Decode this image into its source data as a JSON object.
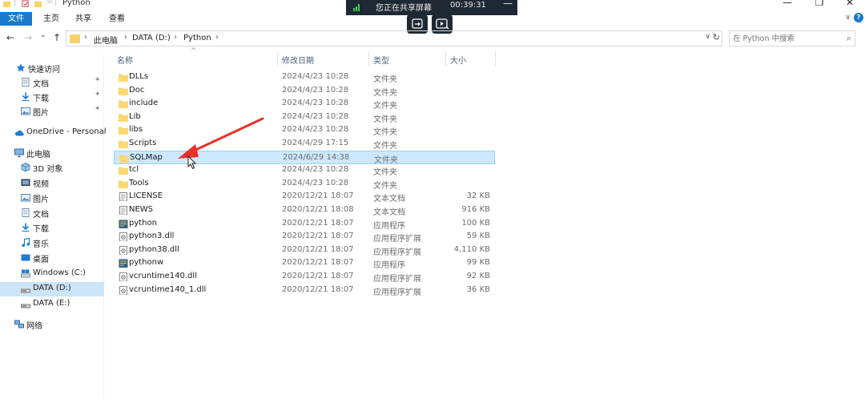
{
  "window": {
    "title": "Python",
    "controls": {
      "minimize": "—",
      "maximize": "❐",
      "close": "✕"
    }
  },
  "ribbon": {
    "tabs": [
      "文件",
      "主页",
      "共享",
      "查看"
    ],
    "collapse_glyph": "∨",
    "help_glyph": "?"
  },
  "share_overlay": {
    "status": "您正在共享屏幕",
    "timer": "00:39:31",
    "minimize_glyph": "—"
  },
  "navigation": {
    "back": "←",
    "forward": "→",
    "recent": "⌄",
    "up": "↑"
  },
  "address": {
    "breadcrumbs": [
      "此电脑",
      "DATA (D:)",
      "Python"
    ],
    "dropdown_glyph": "∨",
    "refresh_glyph": "↻"
  },
  "search": {
    "placeholder": "在 Python 中搜索",
    "icon_glyph": "⌕"
  },
  "nav_pane": {
    "items": [
      {
        "label": "快速访问",
        "icon": "star-icon",
        "pinned": false
      },
      {
        "label": "文档",
        "icon": "documents-icon",
        "pinned": true
      },
      {
        "label": "下载",
        "icon": "download-icon",
        "pinned": true
      },
      {
        "label": "图片",
        "icon": "pictures-icon",
        "pinned": true
      },
      {
        "label": "OneDrive - Personal",
        "icon": "cloud-icon",
        "pinned": false
      },
      {
        "label": "此电脑",
        "icon": "computer-icon",
        "pinned": false
      },
      {
        "label": "3D 对象",
        "icon": "3d-objects-icon",
        "pinned": false
      },
      {
        "label": "视频",
        "icon": "videos-icon",
        "pinned": false
      },
      {
        "label": "图片",
        "icon": "pictures-icon",
        "pinned": false
      },
      {
        "label": "文档",
        "icon": "documents-icon",
        "pinned": false
      },
      {
        "label": "下载",
        "icon": "download-icon",
        "pinned": false
      },
      {
        "label": "音乐",
        "icon": "music-icon",
        "pinned": false
      },
      {
        "label": "桌面",
        "icon": "desktop-icon",
        "pinned": false
      },
      {
        "label": "Windows (C:)",
        "icon": "drive-c-icon",
        "pinned": false
      },
      {
        "label": "DATA (D:)",
        "icon": "drive-icon",
        "pinned": false,
        "selected": true
      },
      {
        "label": "DATA (E:)",
        "icon": "drive-icon",
        "pinned": false
      },
      {
        "label": "网络",
        "icon": "network-icon",
        "pinned": false
      }
    ],
    "pin_glyph": "✦"
  },
  "columns": {
    "name": "名称",
    "date": "修改日期",
    "type": "类型",
    "size": "大小",
    "sort_glyph": "^"
  },
  "files": [
    {
      "name": "DLLs",
      "date": "2024/4/23 10:28",
      "type": "文件夹",
      "size": "",
      "icon": "folder-icon"
    },
    {
      "name": "Doc",
      "date": "2024/4/23 10:28",
      "type": "文件夹",
      "size": "",
      "icon": "folder-icon"
    },
    {
      "name": "include",
      "date": "2024/4/23 10:28",
      "type": "文件夹",
      "size": "",
      "icon": "folder-icon"
    },
    {
      "name": "Lib",
      "date": "2024/4/23 10:28",
      "type": "文件夹",
      "size": "",
      "icon": "folder-icon"
    },
    {
      "name": "libs",
      "date": "2024/4/23 10:28",
      "type": "文件夹",
      "size": "",
      "icon": "folder-icon"
    },
    {
      "name": "Scripts",
      "date": "2024/4/29 17:15",
      "type": "文件夹",
      "size": "",
      "icon": "folder-icon"
    },
    {
      "name": "SQLMap",
      "date": "2024/6/29 14:38",
      "type": "文件夹",
      "size": "",
      "icon": "folder-icon",
      "selected": true
    },
    {
      "name": "tcl",
      "date": "2024/4/23 10:28",
      "type": "文件夹",
      "size": "",
      "icon": "folder-icon"
    },
    {
      "name": "Tools",
      "date": "2024/4/23 10:28",
      "type": "文件夹",
      "size": "",
      "icon": "folder-icon"
    },
    {
      "name": "LICENSE",
      "date": "2020/12/21 18:07",
      "type": "文本文档",
      "size": "32 KB",
      "icon": "text-file-icon"
    },
    {
      "name": "NEWS",
      "date": "2020/12/21 18:08",
      "type": "文本文档",
      "size": "916 KB",
      "icon": "text-file-icon"
    },
    {
      "name": "python",
      "date": "2020/12/21 18:07",
      "type": "应用程序",
      "size": "100 KB",
      "icon": "python-app-icon"
    },
    {
      "name": "python3.dll",
      "date": "2020/12/21 18:07",
      "type": "应用程序扩展",
      "size": "59 KB",
      "icon": "dll-icon"
    },
    {
      "name": "python38.dll",
      "date": "2020/12/21 18:07",
      "type": "应用程序扩展",
      "size": "4,110 KB",
      "icon": "dll-icon"
    },
    {
      "name": "pythonw",
      "date": "2020/12/21 18:07",
      "type": "应用程序",
      "size": "99 KB",
      "icon": "python-app-icon"
    },
    {
      "name": "vcruntime140.dll",
      "date": "2020/12/21 18:07",
      "type": "应用程序扩展",
      "size": "92 KB",
      "icon": "dll-icon"
    },
    {
      "name": "vcruntime140_1.dll",
      "date": "2020/12/21 18:07",
      "type": "应用程序扩展",
      "size": "36 KB",
      "icon": "dll-icon"
    }
  ],
  "colors": {
    "accent": "#1979ca",
    "folder": "#f7d26c",
    "selection": "#cce8ff",
    "annotation_arrow": "#e8322b"
  }
}
